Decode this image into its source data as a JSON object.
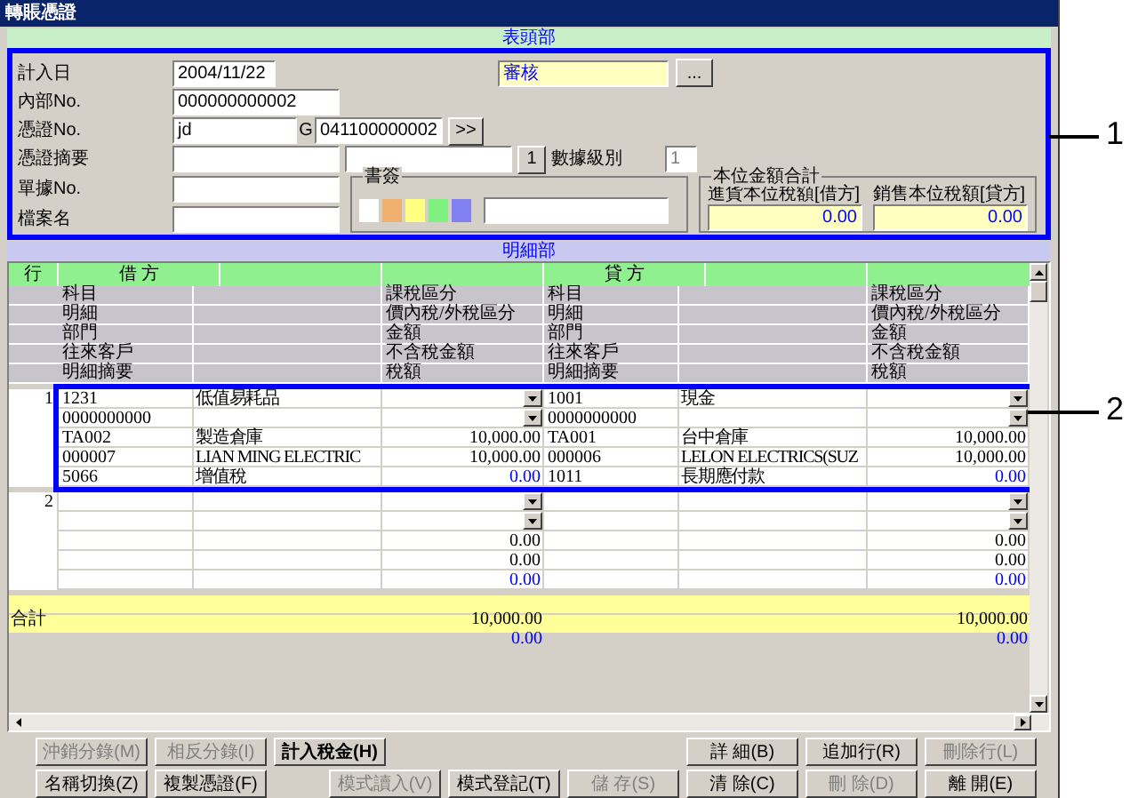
{
  "window": {
    "title": "轉賬憑證"
  },
  "header": {
    "section_label": "表頭部",
    "framed": true,
    "entry_date": {
      "label": "計入日",
      "value": "2004/11/22"
    },
    "status": {
      "value": "審核",
      "button": "..."
    },
    "internal_no": {
      "label": "內部No.",
      "value": "000000000002"
    },
    "voucher_no": {
      "label": "憑證No.",
      "value": "jd",
      "g_label": "G",
      "g_value": "041100000002",
      "button": ">>"
    },
    "summary": {
      "label": "憑證摘要",
      "button": "1"
    },
    "data_level": {
      "label": "數據級別",
      "value": "1",
      "disabled": true
    },
    "slip_no": {
      "label": "單據No."
    },
    "file_name": {
      "label": "檔案名"
    },
    "bookmark": {
      "label": "書簽",
      "swatches": [
        {
          "color": "#ffffff"
        },
        {
          "color": "#f0b070"
        },
        {
          "color": "#ffff80"
        },
        {
          "color": "#80f080"
        },
        {
          "color": "#8080f0"
        }
      ]
    },
    "totals": {
      "label": "本位金額合計",
      "fields": [
        {
          "label": "進貨本位稅額[借方]",
          "value": "0.00"
        },
        {
          "label": "銷售本位稅額[貸方]",
          "value": "0.00"
        }
      ]
    }
  },
  "detail": {
    "section_label": "明細部",
    "columns": {
      "line": "行",
      "debit": "借 方",
      "credit": "貸 方"
    },
    "sub_header": [
      {
        "debit": [
          "科目",
          "課稅區分"
        ],
        "credit": [
          "科目",
          "課稅區分"
        ]
      },
      {
        "debit": [
          "明細",
          "價內稅/外稅區分"
        ],
        "credit": [
          "明細",
          "價內稅/外稅區分"
        ]
      },
      {
        "debit": [
          "部門",
          "金額"
        ],
        "credit": [
          "部門",
          "金額"
        ]
      },
      {
        "debit": [
          "往來客戶",
          "不含稅金額"
        ],
        "credit": [
          "往來客戶",
          "不含稅金額"
        ]
      },
      {
        "debit": [
          "明細摘要",
          "稅額"
        ],
        "credit": [
          "明細摘要",
          "稅額"
        ]
      }
    ],
    "entries": [
      {
        "line_no": "1",
        "framed": true,
        "lines": [
          {
            "kind": "select",
            "debit": {
              "code": "1231",
              "name": "低值易耗品"
            },
            "credit": {
              "code": "1001",
              "name": "現金"
            }
          },
          {
            "kind": "select",
            "debit": {
              "code": "0000000000"
            },
            "credit": {
              "code": "0000000000"
            }
          },
          {
            "kind": "amount",
            "debit": {
              "code": "TA002",
              "name": "製造倉庫",
              "amount": "10,000.00"
            },
            "credit": {
              "code": "TA001",
              "name": "台中倉庫",
              "amount": "10,000.00"
            }
          },
          {
            "kind": "amount",
            "debit": {
              "code": "000007",
              "name": "LIAN MING ELECTRIC",
              "amount": "10,000.00"
            },
            "credit": {
              "code": "000006",
              "name": "LELON ELECTRICS(SUZ",
              "amount": "10,000.00"
            }
          },
          {
            "kind": "tax",
            "debit": {
              "code": "5066",
              "name": "增值稅",
              "amount": "0.00"
            },
            "credit": {
              "code": "1011",
              "name": "長期應付款",
              "amount": "0.00"
            }
          }
        ]
      },
      {
        "line_no": "2",
        "framed": false,
        "lines": [
          {
            "kind": "select"
          },
          {
            "kind": "select"
          },
          {
            "kind": "amount",
            "debit": {
              "amount": "0.00"
            },
            "credit": {
              "amount": "0.00"
            }
          },
          {
            "kind": "amount",
            "debit": {
              "amount": "0.00"
            },
            "credit": {
              "amount": "0.00"
            }
          },
          {
            "kind": "tax",
            "debit": {
              "amount": "0.00"
            },
            "credit": {
              "amount": "0.00"
            }
          }
        ]
      }
    ],
    "totals": {
      "label": "合計",
      "rows": [
        {
          "kind": "amount",
          "debit": "10,000.00",
          "credit": "10,000.00"
        },
        {
          "kind": "tax",
          "debit": "0.00",
          "credit": "0.00"
        }
      ]
    }
  },
  "toolbar": [
    {
      "left": [
        {
          "label": "沖銷分錄(M)",
          "disabled": true
        },
        {
          "label": "相反分錄(I)",
          "disabled": true
        },
        {
          "label": "計入稅金(H)",
          "disabled": false
        }
      ],
      "right": [
        {
          "label": "詳 細(B)",
          "disabled": false
        },
        {
          "label": "追加行(R)",
          "disabled": false
        },
        {
          "label": "刪除行(L)",
          "disabled": true
        }
      ]
    },
    {
      "left": [
        {
          "label": "名稱切換(Z)",
          "disabled": false
        },
        {
          "label": "複製憑證(F)",
          "disabled": false
        }
      ],
      "right": [
        {
          "label": "模式讀入(V)",
          "disabled": true
        },
        {
          "label": "模式登記(T)",
          "disabled": false
        },
        {
          "label": "儲 存(S)",
          "disabled": true
        },
        {
          "label": "清 除(C)",
          "disabled": false
        },
        {
          "label": "刪 除(D)",
          "disabled": true
        },
        {
          "label": "離 開(E)",
          "disabled": false
        }
      ]
    }
  ],
  "callouts": [
    {
      "label": "1"
    },
    {
      "label": "2"
    }
  ]
}
